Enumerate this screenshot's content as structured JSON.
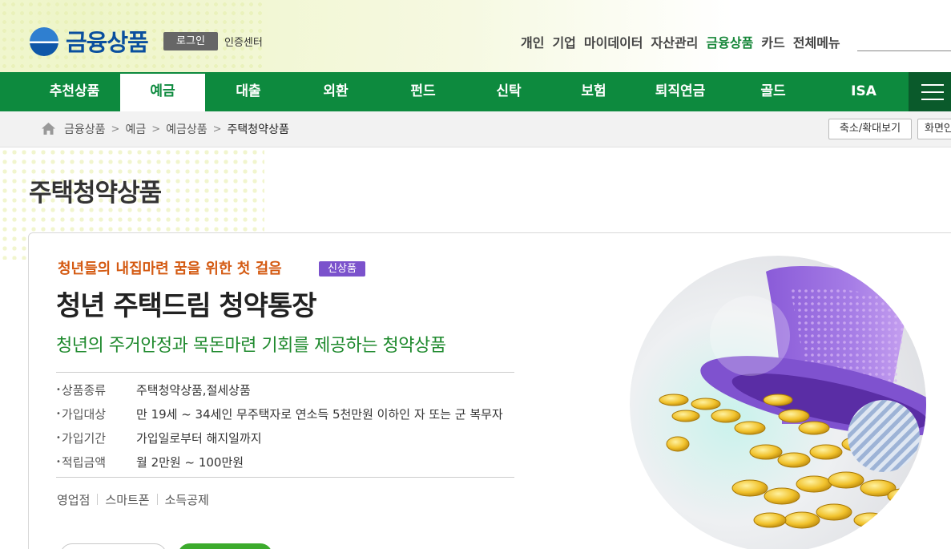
{
  "header": {
    "site_title": "금융상품",
    "login_label": "로그인",
    "cert_label": "인증센터",
    "util_menu": [
      "개인",
      "기업",
      "마이데이터",
      "자산관리",
      "금융상품",
      "카드",
      "전체메뉴"
    ],
    "active_util": "금융상품"
  },
  "gnb": {
    "items": [
      "추천상품",
      "예금",
      "대출",
      "외환",
      "펀드",
      "신탁",
      "보험",
      "퇴직연금",
      "골드",
      "ISA"
    ],
    "active": "예금",
    "menu_icon": "hamburger-icon"
  },
  "breadcrumb": {
    "items": [
      "금융상품",
      "예금",
      "예금상품",
      "주택청약상품"
    ],
    "zoom_label": "축소/확대보기",
    "print_label": "화면인쇄"
  },
  "page_title": "주택청약상품",
  "product": {
    "tagline": "청년들의 내집마련 꿈을 위한 첫 걸음",
    "badge": "신상품",
    "name": "청년 주택드림 청약통장",
    "description": "청년의 주거안정과 목돈마련 기회를 제공하는 청약상품",
    "specs": [
      {
        "label": "상품종류",
        "value": "주택청약상품,절세상품"
      },
      {
        "label": "가입대상",
        "value": "만 19세 ~ 34세인 무주택자로 연소득 5천만원 이하인 자 또는 군 복무자"
      },
      {
        "label": "가입기간",
        "value": "가입일로부터 해지일까지"
      },
      {
        "label": "적립금액",
        "value": "월 2만원 ~ 100만원"
      }
    ],
    "channels": [
      "영업점",
      "스마트폰",
      "소득공제"
    ]
  },
  "colors": {
    "brand_green": "#0d8a3e",
    "tagline_orange": "#d45a12",
    "badge_purple": "#7b52cc",
    "logo_blue": "#0a4f9e"
  }
}
